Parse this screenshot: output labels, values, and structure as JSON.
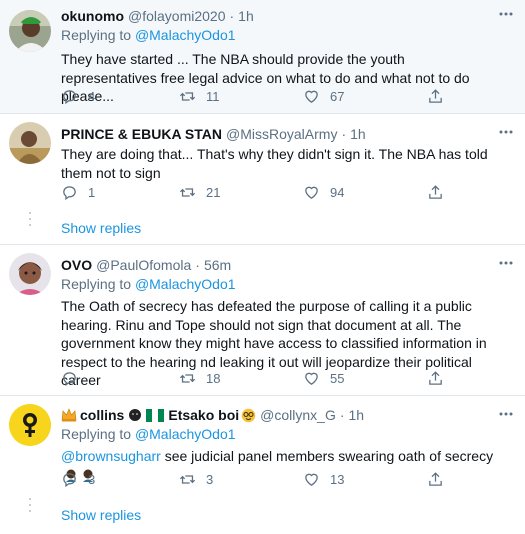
{
  "tweets": [
    {
      "name": "okunomo",
      "handle": "@folayomi2020",
      "time": "1h",
      "replying_prefix": "Replying to",
      "replying_to": "@MalachyOdo1",
      "text": "They have started ... The NBA should provide the youth representatives free legal advice on what to do and what not to do please...",
      "replies": "4",
      "retweets": "11",
      "likes": "67"
    },
    {
      "name": "PRINCE & EBUKA STAN",
      "handle": "@MissRoyalArmy",
      "time": "1h",
      "text": "They are doing that... That's why they didn't sign it. The NBA has told them not to sign",
      "replies": "1",
      "retweets": "21",
      "likes": "94"
    },
    {
      "name": "OVO",
      "handle": "@PaulOfomola",
      "time": "56m",
      "replying_prefix": "Replying to",
      "replying_to": "@MalachyOdo1",
      "text": "The Oath of secrecy has defeated the purpose of calling it a public hearing. Rinu and Tope should not sign that document at all. The government know they might have access to classified information in respect to the hearing nd leaking it out will jeopardize their political career",
      "replies": "",
      "retweets": "18",
      "likes": "55"
    },
    {
      "name_part1": "collins",
      "name_part2": "Etsako boi",
      "handle": "@collynx_G",
      "time": "1h",
      "replying_prefix": "Replying to",
      "replying_to": "@MalachyOdo1",
      "text_mention": "@brownsugharr",
      "text": " see judicial panel members swearing oath of secrecy",
      "replies": "3",
      "retweets": "3",
      "likes": "13"
    }
  ],
  "show_replies_label": "Show replies",
  "separator": "·",
  "colors": {
    "accent": "#1b95e0",
    "secondary_text": "#5b7083",
    "primary_text": "#0f1419",
    "highlight_bg": "#f5f8fa",
    "divider": "#e1e8ed"
  }
}
